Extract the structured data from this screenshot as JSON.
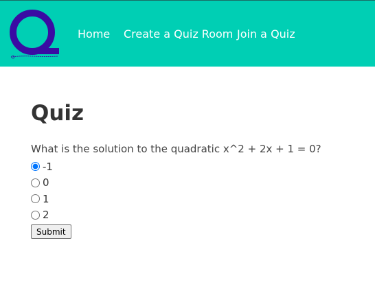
{
  "navbar": {
    "logo_icon": "quiz-q-logo",
    "links": [
      {
        "label": "Home"
      },
      {
        "label": "Create a Quiz Room"
      },
      {
        "label": "Join a Quiz"
      }
    ]
  },
  "main": {
    "title": "Quiz",
    "question": "What is the solution to the quadratic x^2 + 2x + 1 = 0?",
    "options": [
      {
        "label": "-1",
        "checked": true
      },
      {
        "label": "0",
        "checked": false
      },
      {
        "label": "1",
        "checked": false
      },
      {
        "label": "2",
        "checked": false
      }
    ],
    "submit_label": "Submit"
  },
  "colors": {
    "navbar_bg": "#00cfb4",
    "logo": "#3a0ca3"
  }
}
